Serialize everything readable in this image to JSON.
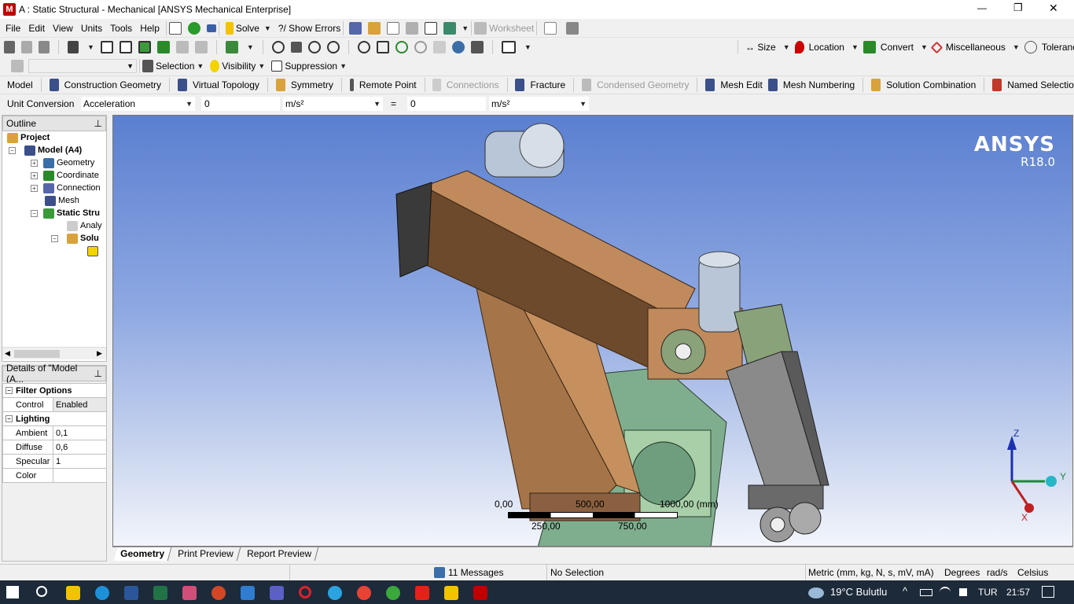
{
  "window": {
    "title": "A : Static Structural - Mechanical [ANSYS Mechanical Enterprise]",
    "minimize": "—",
    "maximize": "❐",
    "close": "✕"
  },
  "menu": [
    "File",
    "Edit",
    "View",
    "Units",
    "Tools",
    "Help"
  ],
  "toolbar1": {
    "solve": "Solve",
    "show_errors": "?/ Show Errors",
    "worksheet": "Worksheet"
  },
  "toolbar2": {
    "size": "↔ Size",
    "location": "Location",
    "convert": "Convert",
    "miscellaneous": "Miscellaneous",
    "tolerances": "Tolerances"
  },
  "toolbar3": {
    "selection": "Selection",
    "visibility": "Visibility",
    "suppression": "Suppression"
  },
  "context": {
    "model": "Model",
    "construction_geometry": "Construction Geometry",
    "virtual_topology": "Virtual Topology",
    "symmetry": "Symmetry",
    "remote_point": "Remote Point",
    "connections": "Connections",
    "fracture": "Fracture",
    "condensed_geometry": "Condensed Geometry",
    "mesh_edit": "Mesh Edit",
    "mesh_numbering": "Mesh Numbering",
    "solution_combination": "Solution Combination",
    "named_selections": "Named Selectio"
  },
  "unit_conversion": {
    "label": "Unit Conversion",
    "quantity": "Acceleration",
    "value1": "0",
    "unit1": "m/s²",
    "equals": "=",
    "value2": "0",
    "unit2": "m/s²"
  },
  "outline": {
    "title": "Outline",
    "pin": "⊥",
    "items": [
      "Project",
      "Model (A4)",
      "Geometry",
      "Coordinate",
      "Connection",
      "Mesh",
      "Static Stru",
      "Analy",
      "Solu",
      ""
    ]
  },
  "details": {
    "title": "Details of \"Model (A...",
    "pin": "⊥",
    "sections": {
      "filter": "Filter Options",
      "lighting": "Lighting"
    },
    "rows": [
      {
        "k": "Control",
        "v": "Enabled"
      },
      {
        "k": "Ambient",
        "v": "0,1"
      },
      {
        "k": "Diffuse",
        "v": "0,6"
      },
      {
        "k": "Specular",
        "v": "1"
      },
      {
        "k": "Color",
        "v": ""
      }
    ]
  },
  "viewport": {
    "brand": "ANSYS",
    "version": "R18.0",
    "scale_top": [
      "0,00",
      "500,00",
      "1000,00 (mm)"
    ],
    "scale_bottom": [
      "250,00",
      "750,00"
    ],
    "axis": {
      "z": "Z",
      "y": "Y",
      "x": "X"
    }
  },
  "tabs": [
    "Geometry",
    "Print Preview",
    "Report Preview"
  ],
  "status": {
    "messages": "11 Messages",
    "selection": "No Selection",
    "units": "Metric (mm, kg, N, s, mV, mA)",
    "angle": "Degrees",
    "rate": "rad/s",
    "temp": "Celsius"
  },
  "taskbar": {
    "weather": "19°C  Bulutlu",
    "lang": "TUR",
    "time": "21:57"
  },
  "colors": {
    "accent": "#c00000",
    "viewport_top": "#5b7fd0",
    "arm": "#c08a5c",
    "taskbar": "#1c2a3a"
  }
}
